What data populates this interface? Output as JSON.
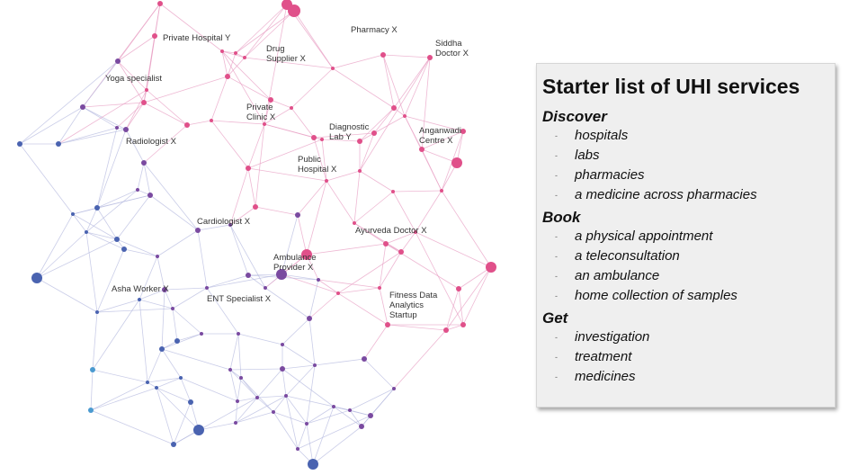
{
  "network": {
    "labels": [
      "Private Hospital Y",
      "Drug\nSupplier X",
      "Pharmacy X",
      "Siddha\nDoctor X",
      "Yoga specialist",
      "Private\nClinic X",
      "Diagnostic\nLab Y",
      "Anganwadi\nCentre X",
      "Radiologist X",
      "Public\nHospital X",
      "Cardiologist X",
      "Ayurveda Doctor X",
      "Ambulance\nProvider X",
      "Asha Worker X",
      "ENT Specialist X",
      "Fitness Data\nAnalytics\nStartup"
    ],
    "colors": {
      "blue": "#4a63b0",
      "purple": "#7a4aa0",
      "pink": "#e0508a",
      "light_blue": "#4a9ad0"
    }
  },
  "panel": {
    "title": "Starter list of UHI services",
    "bullet": "-",
    "sections": [
      {
        "heading": "Discover",
        "items": [
          "hospitals",
          "labs",
          "pharmacies",
          "a medicine across pharmacies"
        ]
      },
      {
        "heading": "Book",
        "items": [
          "a physical appointment",
          "a teleconsultation",
          "an ambulance",
          "home collection of samples"
        ]
      },
      {
        "heading": "Get",
        "items": [
          "investigation",
          "treatment",
          "medicines"
        ]
      }
    ]
  }
}
